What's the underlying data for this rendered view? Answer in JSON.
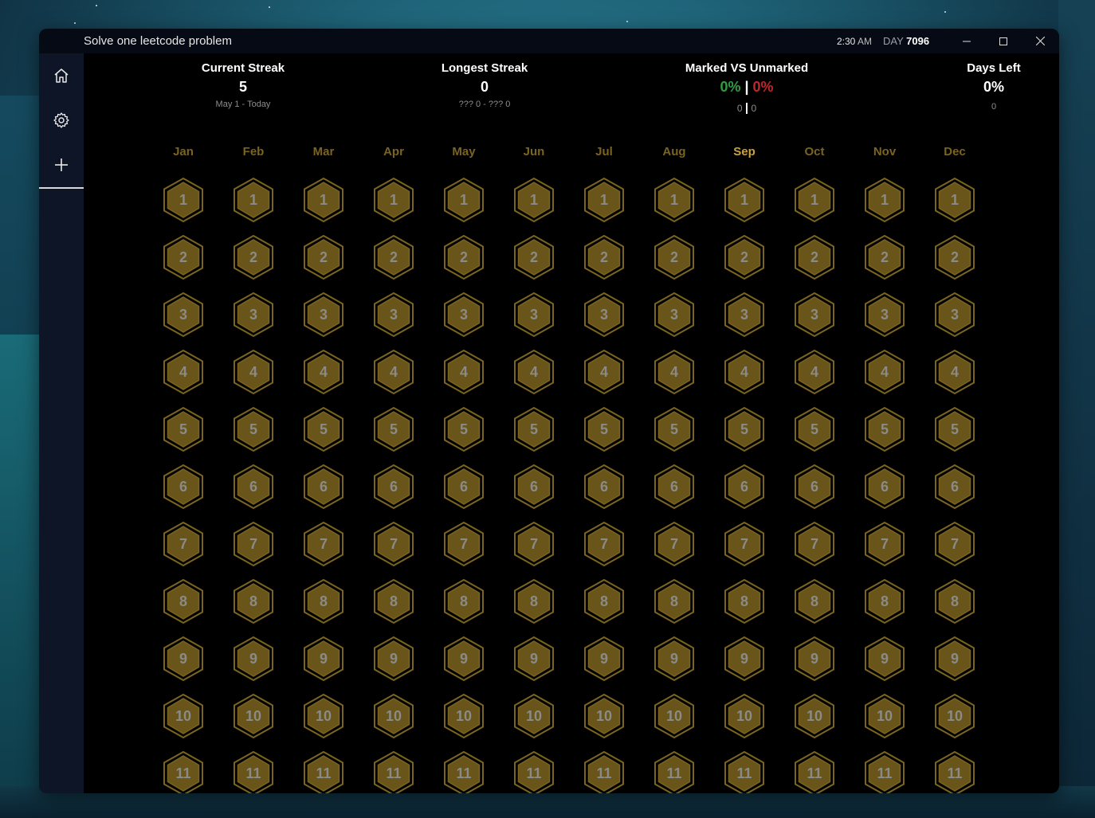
{
  "window": {
    "title": "Solve one leetcode problem",
    "time": "2:30",
    "ampm": "AM",
    "day_label": "DAY",
    "day_number": "7096"
  },
  "controls": {
    "minimize_icon": "minimize-icon",
    "maximize_icon": "maximize-icon",
    "close_icon": "close-icon"
  },
  "sidebar": {
    "items": [
      {
        "icon": "home-icon"
      },
      {
        "icon": "gear-icon"
      },
      {
        "icon": "plus-icon"
      }
    ]
  },
  "stats": {
    "current_streak": {
      "label": "Current Streak",
      "value": "5",
      "sub": "May 1 - Today"
    },
    "longest_streak": {
      "label": "Longest Streak",
      "value": "0",
      "sub": "??? 0 - ??? 0"
    },
    "marked_vs_unmarked": {
      "label": "Marked VS Unmarked",
      "marked_pct": "0%",
      "separator": "|",
      "unmarked_pct": "0%",
      "marked_count": "0",
      "unmarked_count": "0"
    },
    "days_left": {
      "label": "Days Left",
      "value": "0%",
      "sub": "0"
    }
  },
  "calendar": {
    "months": [
      "Jan",
      "Feb",
      "Mar",
      "Apr",
      "May",
      "Jun",
      "Jul",
      "Aug",
      "Sep",
      "Oct",
      "Nov",
      "Dec"
    ],
    "current_month_index": 8,
    "visible_days": [
      "1",
      "2",
      "3",
      "4",
      "5",
      "6",
      "7",
      "8",
      "9",
      "10",
      "11"
    ]
  },
  "colors": {
    "hex_fill": "#695419",
    "hex_stroke": "#7a6420",
    "marked_green": "#2e9e41",
    "unmarked_red": "#c0262b"
  }
}
